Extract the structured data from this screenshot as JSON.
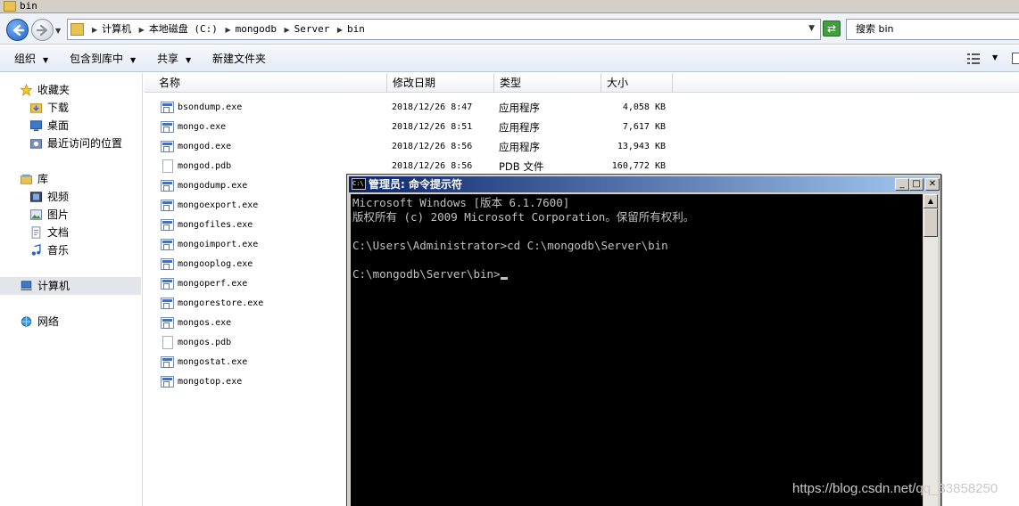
{
  "window": {
    "title": "bin"
  },
  "address": {
    "crumbs": [
      "计算机",
      "本地磁盘 (C:)",
      "mongodb",
      "Server",
      "bin"
    ]
  },
  "search": {
    "value": "搜索 bin"
  },
  "toolbar": {
    "organize": "组织",
    "include_in_library": "包含到库中",
    "share": "共享",
    "new_folder": "新建文件夹"
  },
  "navpane": {
    "favorites": {
      "label": "收藏夹",
      "items": [
        "下载",
        "桌面",
        "最近访问的位置"
      ]
    },
    "libraries": {
      "label": "库",
      "items": [
        "视频",
        "图片",
        "文档",
        "音乐"
      ]
    },
    "computer": "计算机",
    "network": "网络"
  },
  "columns": {
    "name": "名称",
    "date": "修改日期",
    "type": "类型",
    "size": "大小"
  },
  "files": [
    {
      "name": "bsondump.exe",
      "date": "2018/12/26 8:47",
      "type": "应用程序",
      "size": "4,058 KB",
      "icon": "exe"
    },
    {
      "name": "mongo.exe",
      "date": "2018/12/26 8:51",
      "type": "应用程序",
      "size": "7,617 KB",
      "icon": "exe"
    },
    {
      "name": "mongod.exe",
      "date": "2018/12/26 8:56",
      "type": "应用程序",
      "size": "13,943 KB",
      "icon": "exe"
    },
    {
      "name": "mongod.pdb",
      "date": "2018/12/26 8:56",
      "type": "PDB 文件",
      "size": "160,772 KB",
      "icon": "doc"
    },
    {
      "name": "mongodump.exe",
      "date": "",
      "type": "",
      "size": "",
      "icon": "exe"
    },
    {
      "name": "mongoexport.exe",
      "date": "",
      "type": "",
      "size": "",
      "icon": "exe"
    },
    {
      "name": "mongofiles.exe",
      "date": "",
      "type": "",
      "size": "",
      "icon": "exe"
    },
    {
      "name": "mongoimport.exe",
      "date": "",
      "type": "",
      "size": "",
      "icon": "exe"
    },
    {
      "name": "mongooplog.exe",
      "date": "",
      "type": "",
      "size": "",
      "icon": "exe"
    },
    {
      "name": "mongoperf.exe",
      "date": "",
      "type": "",
      "size": "",
      "icon": "exe"
    },
    {
      "name": "mongorestore.exe",
      "date": "",
      "type": "",
      "size": "",
      "icon": "exe"
    },
    {
      "name": "mongos.exe",
      "date": "",
      "type": "",
      "size": "",
      "icon": "exe"
    },
    {
      "name": "mongos.pdb",
      "date": "",
      "type": "",
      "size": "",
      "icon": "doc"
    },
    {
      "name": "mongostat.exe",
      "date": "",
      "type": "",
      "size": "",
      "icon": "exe"
    },
    {
      "name": "mongotop.exe",
      "date": "",
      "type": "",
      "size": "",
      "icon": "exe"
    }
  ],
  "cmd": {
    "title": "管理员: 命令提示符",
    "icon_text": "C:\\",
    "lines": [
      "Microsoft Windows [版本 6.1.7600]",
      "版权所有 (c) 2009 Microsoft Corporation。保留所有权利。",
      "",
      "C:\\Users\\Administrator>cd C:\\mongodb\\Server\\bin",
      "",
      "C:\\mongodb\\Server\\bin>"
    ]
  },
  "watermark": "https://blog.csdn.net/qq_33858250",
  "colors": {
    "cmd_bg": "#000000",
    "cmd_text": "#c0c0c0",
    "title_gradient_start": "#0a246a",
    "title_gradient_end": "#a6caf0"
  }
}
